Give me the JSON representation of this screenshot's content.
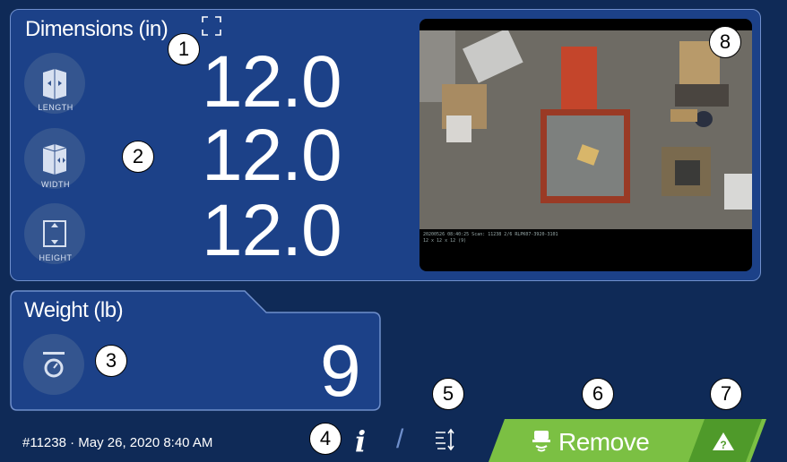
{
  "dimensions": {
    "title": "Dimensions (in)",
    "length": {
      "label": "LENGTH",
      "value": "12.0"
    },
    "width": {
      "label": "WIDTH",
      "value": "12.0"
    },
    "height": {
      "label": "HEIGHT",
      "value": "12.0"
    }
  },
  "weight": {
    "title": "Weight (lb)",
    "value": "9"
  },
  "footer": {
    "scan_info": "#11238 · May 26, 2020 8:40 AM",
    "info_glyph": "i",
    "divider": "/",
    "remove_label": "Remove"
  },
  "camera": {
    "overlay_text": "20200526 08:40:25 Scan: 11238 2/6 RLPK07-3920-3101\n12 x 12 x 12 (9)"
  },
  "callouts": [
    "1",
    "2",
    "3",
    "4",
    "5",
    "6",
    "7",
    "8"
  ],
  "colors": {
    "background": "#0f2a57",
    "panel": "#1c4188",
    "panel_border": "#6f8fcc",
    "remove_button": "#7bc043",
    "warning_button": "#4f9a2a"
  }
}
